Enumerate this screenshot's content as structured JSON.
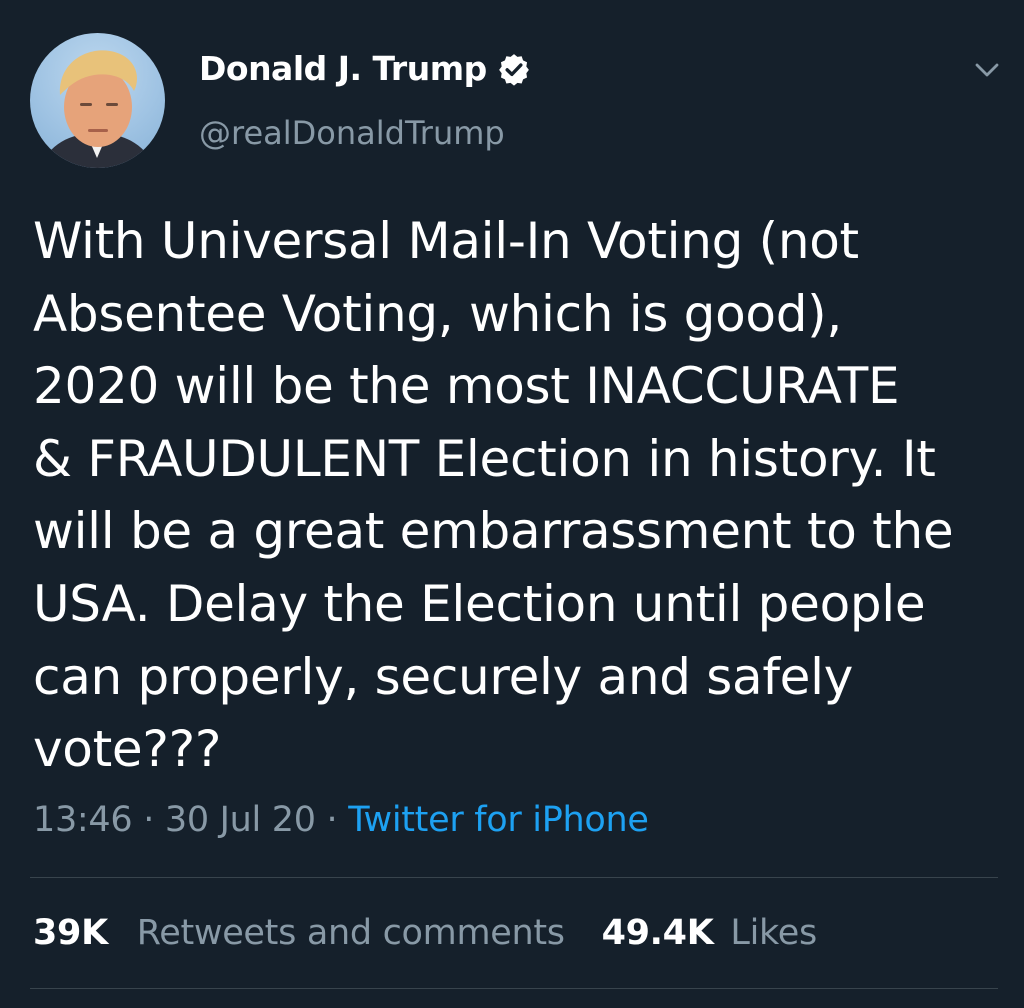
{
  "tweet": {
    "author": {
      "name": "Donald J. Trump",
      "handle": "@realDonaldTrump",
      "verified": true
    },
    "text": "With Universal Mail-In Voting (not\nAbsentee Voting, which is good),\n2020 will be the most INACCURATE\n& FRAUDULENT Election in history. It\nwill be a great embarrassment to the\nUSA. Delay the Election until people\ncan properly, securely and safely\nvote???",
    "time": "13:46",
    "date": "30 Jul 20",
    "separator": "·",
    "source": "Twitter for iPhone",
    "stats": {
      "retweets_count": "39K",
      "retweets_label": "Retweets and comments",
      "likes_count": "49.4K",
      "likes_label": "Likes"
    }
  },
  "icons": {
    "verified": "verified-badge-icon",
    "menu": "chevron-down-icon"
  },
  "colors": {
    "background": "#15202b",
    "text_primary": "#ffffff",
    "text_secondary": "#8899a6",
    "link": "#1da1f2",
    "divider": "#38444d"
  }
}
